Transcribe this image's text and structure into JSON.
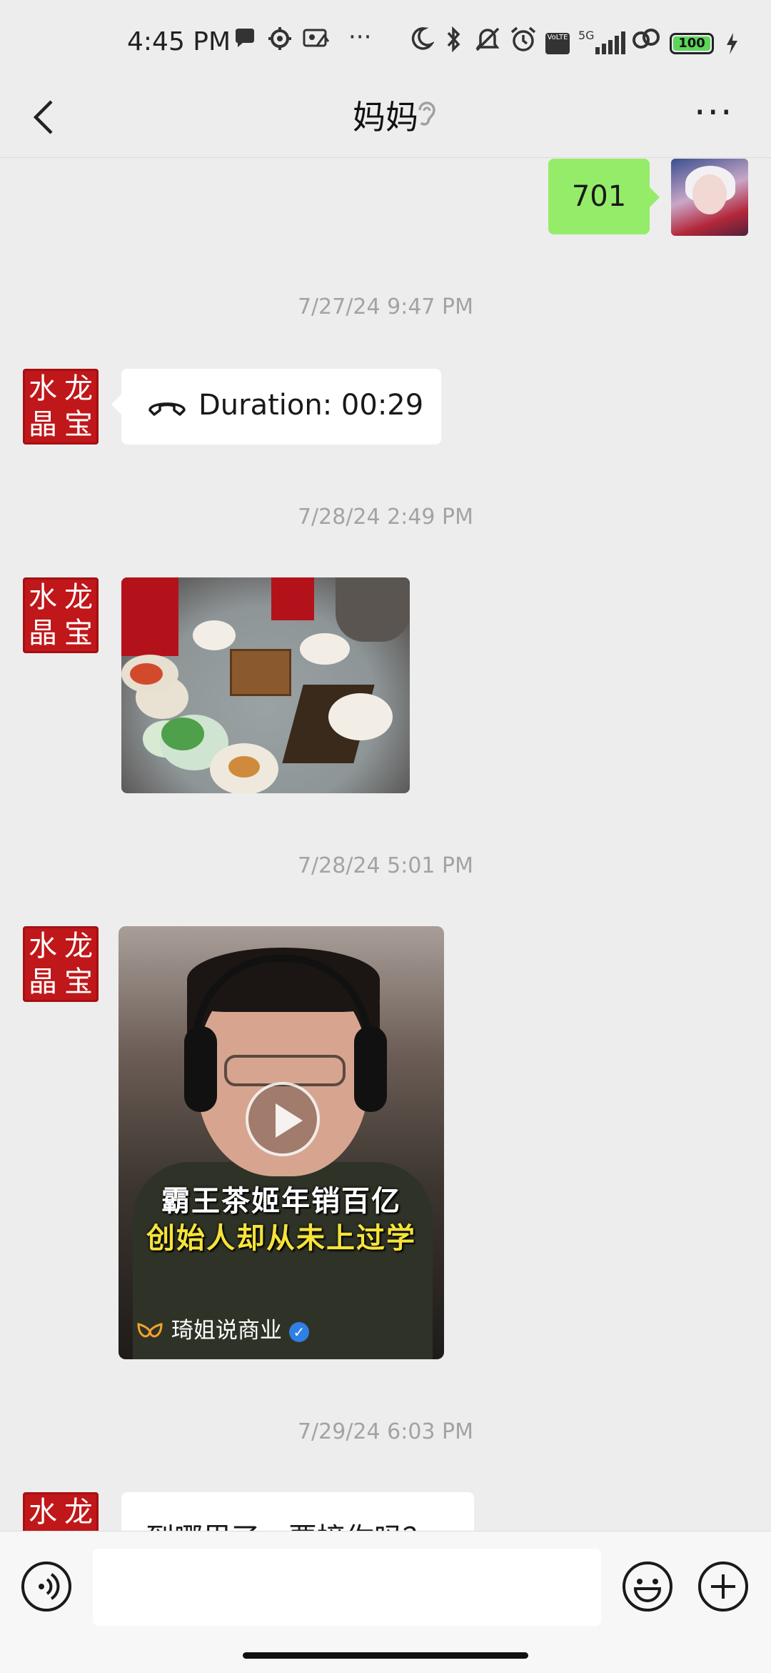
{
  "status_bar": {
    "time": "4:45 PM",
    "icons": [
      "message-icon",
      "gear-icon",
      "photo-icon",
      "more-dots-icon",
      "moon-icon",
      "bluetooth-icon",
      "bell-muted-icon",
      "alarm-icon",
      "volte-icon",
      "5g-signal-icon",
      "link-icon",
      "battery-icon",
      "charging-icon"
    ],
    "overflow": "···",
    "network": "5G",
    "volte": "VoLTE",
    "battery_level": "100"
  },
  "nav": {
    "title": "妈妈",
    "back_icon": "chevron-left-icon",
    "ear_icon": "ear-icon",
    "more": "···"
  },
  "messages": [
    {
      "type": "text",
      "side": "right",
      "text": "701"
    },
    {
      "type": "timestamp",
      "text": "7/27/24 9:47 PM"
    },
    {
      "type": "call",
      "side": "left",
      "text": "Duration: 00:29",
      "avatar_text": "水龙晶宝"
    },
    {
      "type": "timestamp",
      "text": "7/28/24 2:49 PM"
    },
    {
      "type": "image",
      "side": "left",
      "avatar_text": "水龙晶宝"
    },
    {
      "type": "timestamp",
      "text": "7/28/24 5:01 PM"
    },
    {
      "type": "video",
      "side": "left",
      "avatar_text": "水龙晶宝",
      "caption_line1": "霸王茶姬年销百亿",
      "caption_line2": "创始人却从未上过学",
      "source": "琦姐说商业"
    },
    {
      "type": "timestamp",
      "text": "7/29/24 6:03 PM"
    },
    {
      "type": "text",
      "side": "left",
      "text": "到哪里了，要接你吗？",
      "avatar_text": "水龙晶宝"
    }
  ],
  "avatar_chars": [
    "水",
    "龙",
    "晶",
    "宝"
  ],
  "input_bar": {
    "voice_icon": "voice-icon",
    "input_value": "",
    "emoji_icon": "emoji-icon",
    "plus_icon": "plus-icon"
  },
  "colors": {
    "background": "#ededed",
    "self_bubble": "#95ec69",
    "other_bubble": "#ffffff",
    "avatar_red": "#c0171a",
    "timestamp": "#a3a3a3"
  }
}
